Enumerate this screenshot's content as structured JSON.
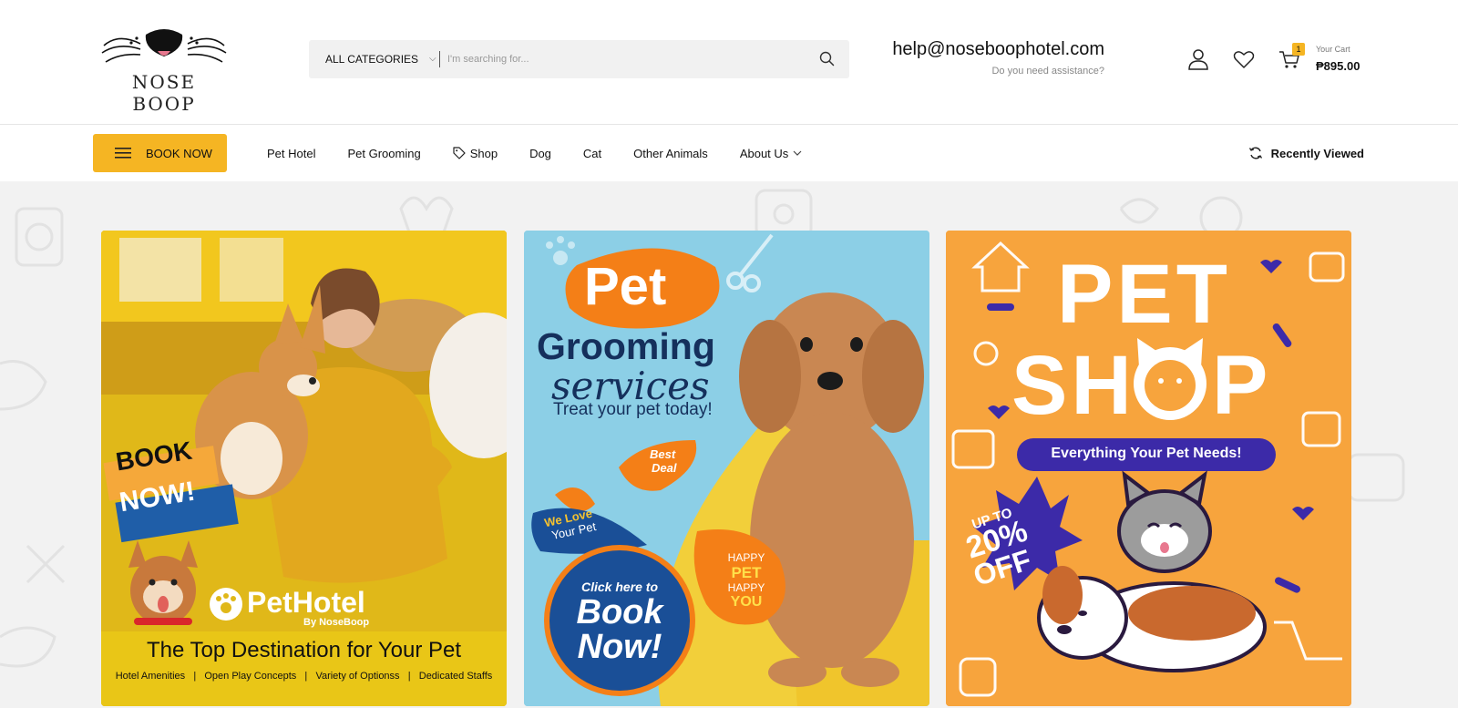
{
  "header": {
    "logo_text": "NOSE BOOP",
    "search": {
      "category": "ALL CATEGORIES",
      "placeholder": "I'm searching for..."
    },
    "contact": {
      "email": "help@noseboophotel.com",
      "tagline": "Do you need assistance?"
    },
    "cart": {
      "count": "1",
      "label": "Your Cart",
      "total": "₱895.00"
    }
  },
  "nav": {
    "book_now": "BOOK NOW",
    "items": [
      {
        "label": "Pet Hotel"
      },
      {
        "label": "Pet Grooming"
      },
      {
        "label": "Shop",
        "icon": "tag-icon"
      },
      {
        "label": "Dog"
      },
      {
        "label": "Cat"
      },
      {
        "label": "Other Animals"
      },
      {
        "label": "About Us",
        "icon": "chevron-down-icon"
      }
    ],
    "recently_viewed": "Recently Viewed"
  },
  "banners": [
    {
      "book_line1": "BOOK",
      "book_line2": "NOW!",
      "brand": "PetHotel",
      "brand_sub": "By NoseBoop",
      "headline": "The Top Destination for Your Pet",
      "features": "Hotel Amenities   |   Open Play Concepts   |   Variety of Optionss   |   Dedicated Staffs"
    },
    {
      "title1": "Pet",
      "title2": "Grooming",
      "title3": "services",
      "tagline": "Treat your pet today!",
      "best_deal_1": "Best",
      "best_deal_2": "Deal",
      "we_love_1": "We Love",
      "we_love_2": "Your Pet",
      "cta_small": "Click here to",
      "cta_big1": "Book",
      "cta_big2": "Now!",
      "happy_1": "HAPPY",
      "happy_2": "PET",
      "happy_3": "HAPPY",
      "happy_4": "YOU"
    },
    {
      "title1": "PET",
      "title2a": "SH",
      "title2b": "P",
      "tagline": "Everything Your Pet Needs!",
      "promo1": "UP TO",
      "promo2": "20%",
      "promo3": "OFF"
    }
  ],
  "colors": {
    "accent": "#f5b523",
    "hotel_yellow": "#e0b819",
    "grooming_blue": "#8ccfe6",
    "shop_orange": "#f7a43d",
    "navy": "#1a4f97",
    "purple": "#3c2aa8"
  }
}
